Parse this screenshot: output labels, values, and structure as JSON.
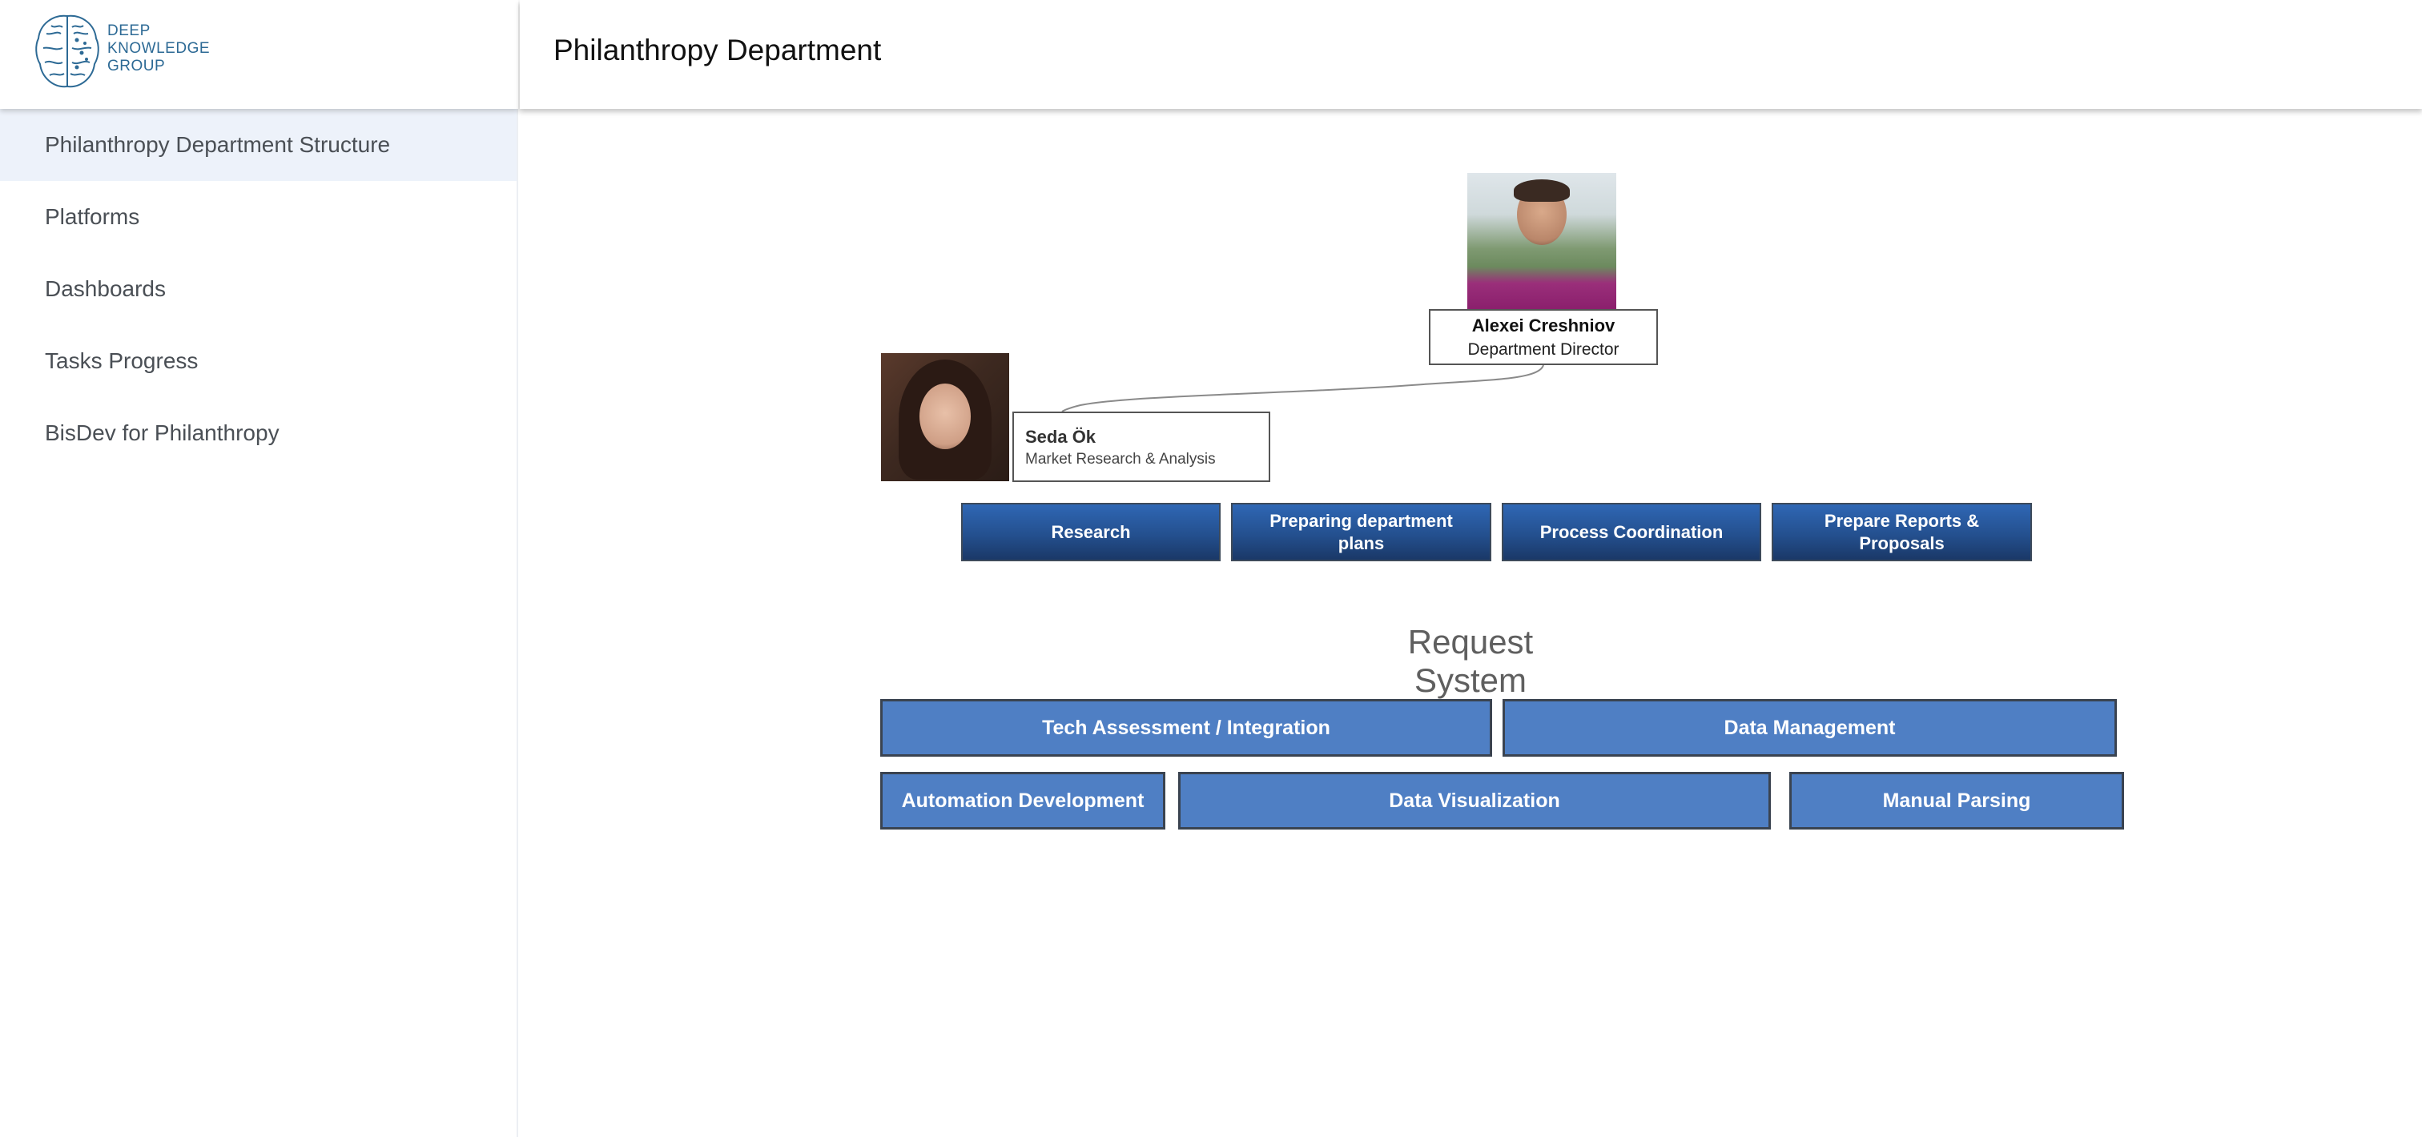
{
  "logo": {
    "line1": "DEEP",
    "line2": "KNOWLEDGE",
    "line3": "GROUP"
  },
  "sidebar": {
    "items": [
      {
        "label": "Philanthropy Department Structure",
        "active": true
      },
      {
        "label": "Platforms",
        "active": false
      },
      {
        "label": "Dashboards",
        "active": false
      },
      {
        "label": "Tasks Progress",
        "active": false
      },
      {
        "label": "BisDev for Philanthropy",
        "active": false
      }
    ]
  },
  "header": {
    "title": "Philanthropy Department"
  },
  "org": {
    "director": {
      "name": "Alexei Creshniov",
      "role": "Department Director"
    },
    "member": {
      "name": "Seda Ök",
      "role": "Market Research & Analysis"
    }
  },
  "tasks": [
    "Research",
    "Preparing department plans",
    "Process Coordination",
    "Prepare Reports & Proposals"
  ],
  "request_system": {
    "title": "Request System",
    "items": [
      "Tech Assessment / Integration",
      "Data Management",
      "Automation Development",
      "Data Visualization",
      "Manual Parsing"
    ]
  },
  "colors": {
    "task_button": "#24508f",
    "request_button": "#4f7fc4",
    "active_nav": "#edf2fa",
    "logo": "#2d6a95"
  }
}
